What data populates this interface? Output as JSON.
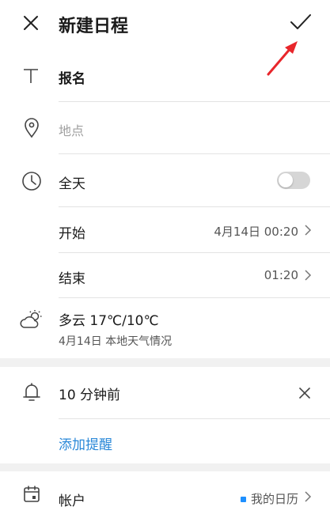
{
  "header": {
    "title": "新建日程",
    "close_icon": "close-icon",
    "confirm_icon": "check-icon"
  },
  "form": {
    "title_field": {
      "value": "报名",
      "icon": "text-icon"
    },
    "location_field": {
      "placeholder": "地点",
      "icon": "location-pin-icon"
    },
    "all_day": {
      "label": "全天",
      "enabled": false,
      "icon": "clock-icon"
    },
    "start": {
      "label": "开始",
      "value": "4月14日 00:20"
    },
    "end": {
      "label": "结束",
      "value": "01:20"
    },
    "weather": {
      "summary": "多云 17℃/10℃",
      "detail": "4月14日 本地天气情况",
      "icon": "partly-cloudy-icon"
    }
  },
  "reminder": {
    "item": "10 分钟前",
    "add_label": "添加提醒",
    "icon": "bell-icon"
  },
  "account": {
    "label": "帐户",
    "value": "我的日历",
    "icon": "calendar-icon",
    "color": "#1e90ff"
  },
  "colors": {
    "accent": "#2a88d8",
    "annotation_arrow": "#e8262b"
  }
}
